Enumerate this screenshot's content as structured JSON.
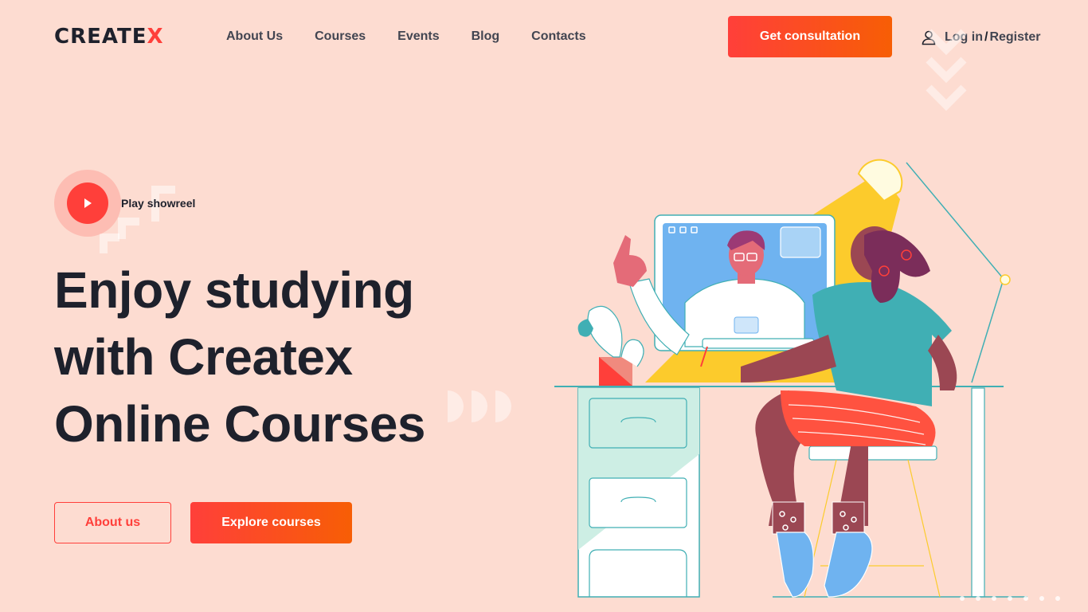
{
  "brand": {
    "logo_text": "CREATE",
    "logo_accent": "X"
  },
  "nav": {
    "items": [
      {
        "label": "About Us"
      },
      {
        "label": "Courses"
      },
      {
        "label": "Events"
      },
      {
        "label": "Blog"
      },
      {
        "label": "Contacts"
      }
    ]
  },
  "header": {
    "cta_label": "Get consultation",
    "login_label": "Log in",
    "separator": "/",
    "register_label": "Register"
  },
  "hero": {
    "showreel_label": "Play showreel",
    "title_line1": "Enjoy studying",
    "title_line2": "with Createx",
    "title_line3": "Online Courses",
    "about_button": "About us",
    "explore_button": "Explore courses"
  },
  "colors": {
    "background": "#fddcd1",
    "accent": "#ff3f3a",
    "accent_gradient_end": "#f75e05",
    "text_dark": "#1e212c",
    "teal": "#40afb4",
    "yellow": "#fccb2c"
  },
  "icons": {
    "user": "user-icon",
    "play": "play-icon"
  }
}
